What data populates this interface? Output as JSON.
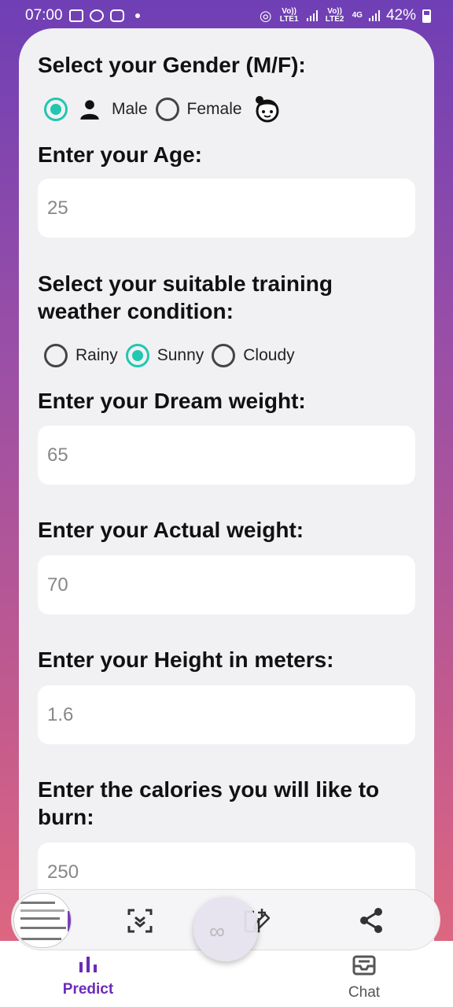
{
  "status_bar": {
    "time": "07:00",
    "net1": "Vo)) LTE1",
    "net2": "Vo)) LTE2",
    "net_type": "4G",
    "battery": "42%"
  },
  "form": {
    "gender": {
      "heading": "Select your Gender (M/F):",
      "options": [
        {
          "label": "Male",
          "selected": true
        },
        {
          "label": "Female",
          "selected": false
        }
      ]
    },
    "age": {
      "heading": "Enter your Age:",
      "value": "25"
    },
    "weather": {
      "heading": "Select your suitable training weather condition:",
      "options": [
        {
          "label": "Rainy",
          "selected": false
        },
        {
          "label": "Sunny",
          "selected": true
        },
        {
          "label": "Cloudy",
          "selected": false
        }
      ]
    },
    "dream_weight": {
      "heading": "Enter your Dream weight:",
      "value": "65"
    },
    "actual_weight": {
      "heading": "Enter your Actual weight:",
      "value": "70"
    },
    "height": {
      "heading": "Enter your Height in meters:",
      "value": "1.6"
    },
    "calories": {
      "heading": "Enter the calories you will like to burn:",
      "value": "250"
    }
  },
  "toolbar": {
    "icons": [
      "screenshot-thumbnail",
      "scan-icon",
      "edit-icon",
      "share-icon"
    ]
  },
  "bottom_nav": {
    "predict": "Predict",
    "chat": "Chat",
    "active_color": "#6a2bb8",
    "inactive_color": "#555555"
  }
}
